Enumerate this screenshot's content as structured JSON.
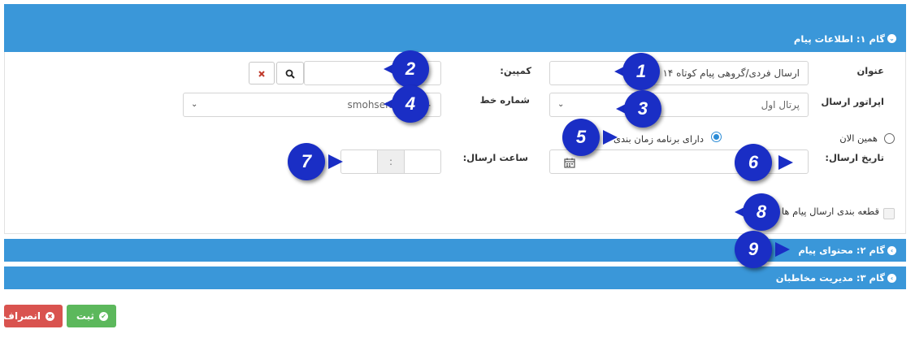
{
  "steps": {
    "step1": "گام ۱: اطلاعات پیام",
    "step2": "گام ۲: محتوای پیام",
    "step3": "گام ۳: مدیریت مخاطبان"
  },
  "form": {
    "title_label": "عنوان",
    "title_value": "ارسال فردی/گروهی پیام کوتاه ۱۴",
    "campaign_label": "کمپین:",
    "operator_label": "اپراتور ارسال",
    "operator_value": "پرتال اول",
    "line_label": "شماره خط",
    "line_value": "smohsenh۶۱:۳۰۰۰",
    "send_now_label": "همین الان",
    "scheduled_label": "دارای برنامه زمان بندی",
    "send_date_label": "تاریخ ارسال:",
    "send_time_label": "ساعت ارسال:",
    "time_separator": ":",
    "segment_label": "قطعه بندی ارسال پیام ها"
  },
  "actions": {
    "submit": "ثبت",
    "cancel": "انصراف"
  },
  "markers": [
    "1",
    "2",
    "3",
    "4",
    "5",
    "6",
    "7",
    "8",
    "9"
  ],
  "colors": {
    "header": "#3a97d9",
    "marker": "#1a2ec5",
    "submit": "#5cb85c",
    "cancel": "#d9534f"
  }
}
